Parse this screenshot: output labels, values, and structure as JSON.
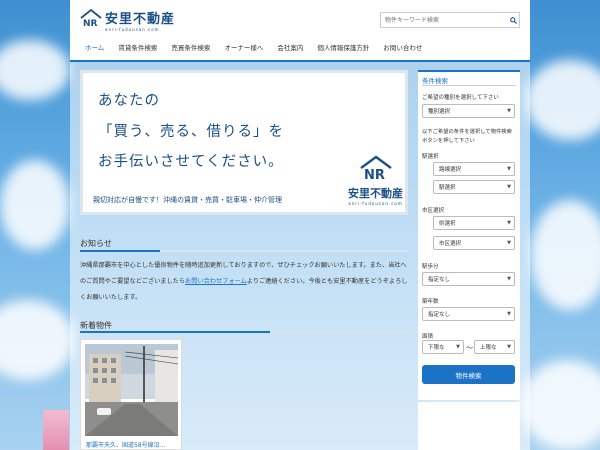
{
  "logo": {
    "name": "安里不動産",
    "domain": "anri-fudousan.com"
  },
  "search": {
    "placeholder": "物件キーワード検索"
  },
  "nav": {
    "items": [
      {
        "label": "ホーム",
        "active": true
      },
      {
        "label": "賃貸条件検索",
        "active": false
      },
      {
        "label": "売買条件検索",
        "active": false
      },
      {
        "label": "オーナー様へ",
        "active": false
      },
      {
        "label": "会社案内",
        "active": false
      },
      {
        "label": "個人情報保護方針",
        "active": false
      },
      {
        "label": "お問い合わせ",
        "active": false
      }
    ]
  },
  "hero": {
    "line1": "あなたの",
    "line2": "「買う、売る、借りる」を",
    "line3": "お手伝いさせてください。",
    "tagline": "親切対応が自慢です！沖縄の賃貸・売買・駐車場・仲介管理",
    "logo_name": "安里不動産",
    "logo_domain": "anri-fudousan.com"
  },
  "notice": {
    "title": "お知らせ",
    "text_before": "沖縄県那覇市を中心とした優良物件を随時追加更新しておりますので、ぜひチェックお願いいたします。また、当社へのご質問やご要望などございましたら",
    "link": "お問い合わせフォーム",
    "text_after": "よりご連絡ください。今後とも安里不動産をどうぞよろしくお願いいたします。"
  },
  "new_listings": {
    "title": "新着物件",
    "items": [
      {
        "caption": "那覇市天久、国道58号線沿..."
      }
    ]
  },
  "sidebar": {
    "title": "条件検索",
    "type_prompt": "ご希望の種別を選択して下さい",
    "type_select": "種別選択",
    "condition_desc": "以下ご希望の条件を選択して物件検索ボタンを押して下さい",
    "station_label": "駅選択",
    "line_select": "路線選択",
    "station_select": "駅選択",
    "area_label": "市区選択",
    "pref_select": "県選択",
    "city_select": "市区選択",
    "walk_label": "駅歩分",
    "walk_select": "指定なし",
    "age_label": "築年数",
    "age_select": "指定なし",
    "area_size_label": "面積",
    "min_select": "下限な",
    "max_select": "上限な",
    "tilde": "〜",
    "search_button": "物件検索"
  },
  "colors": {
    "accent": "#1a73c7",
    "brand": "#1b4f8a"
  }
}
